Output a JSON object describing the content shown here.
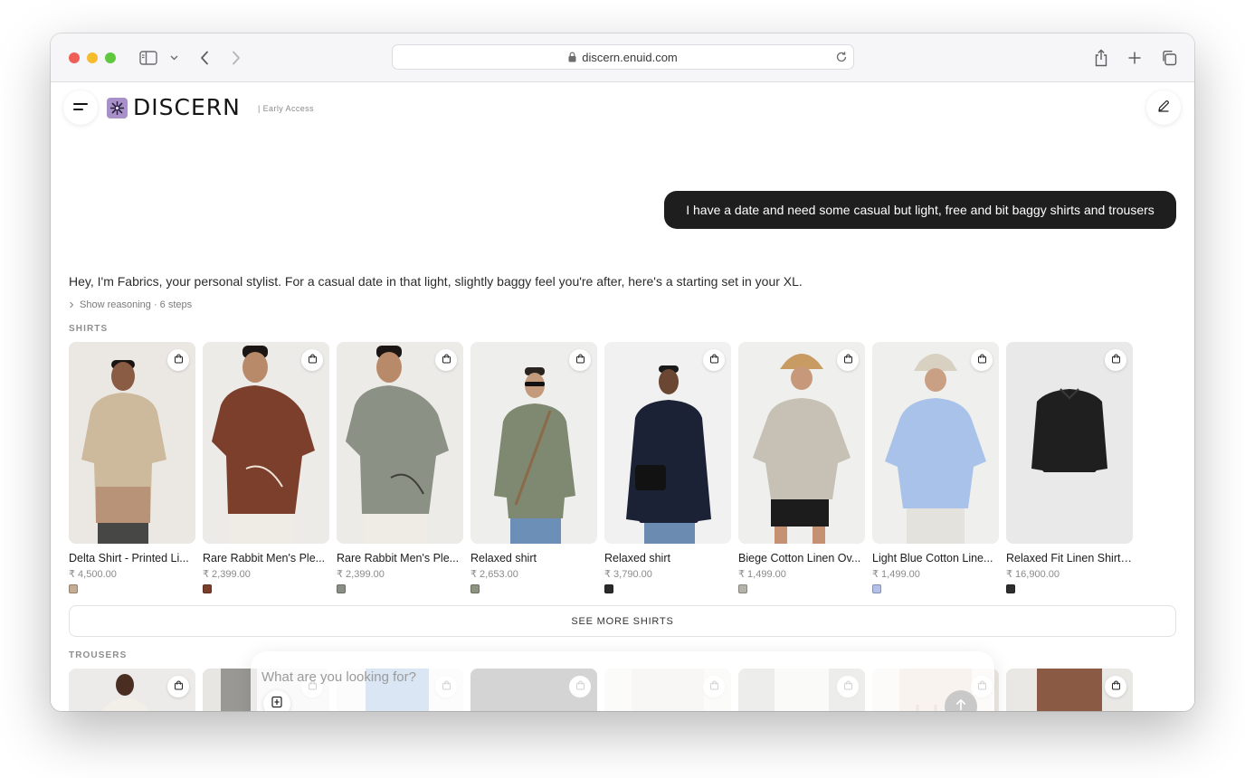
{
  "browser": {
    "url": "discern.enuid.com",
    "icons": [
      "sidebar-icon",
      "chevron-down-icon",
      "back-icon",
      "forward-icon",
      "lock-icon",
      "reload-icon",
      "share-icon",
      "new-tab-icon",
      "tabs-overview-icon"
    ]
  },
  "header": {
    "brand": "DISCERN",
    "badge": "| Early Access",
    "icons": [
      "menu-icon",
      "logo-icon",
      "edit-icon"
    ]
  },
  "chat": {
    "user_message": "I have a date and need some casual but light, free and bit baggy shirts and trousers",
    "assistant_message": "Hey, I'm Fabrics, your personal stylist. For a casual date in that light, slightly baggy feel you're after, here's a starting set in your XL.",
    "reasoning_label": "Show reasoning · 6 steps"
  },
  "shirts": {
    "section_label": "SHIRTS",
    "see_more_label": "SEE MORE SHIRTS",
    "items": [
      {
        "name": "Delta Shirt - Printed Li...",
        "price": "₹ 4,500.00",
        "swatch": "#c4ad93"
      },
      {
        "name": "Rare Rabbit Men's Ple...",
        "price": "₹ 2,399.00",
        "swatch": "#7a3e2a"
      },
      {
        "name": "Rare Rabbit Men's Ple...",
        "price": "₹ 2,399.00",
        "swatch": "#8a8f86"
      },
      {
        "name": "Relaxed shirt",
        "price": "₹ 2,653.00",
        "swatch": "#8e937f"
      },
      {
        "name": "Relaxed shirt",
        "price": "₹ 3,790.00",
        "swatch": "#2a2a2a"
      },
      {
        "name": "Biege Cotton Linen Ov...",
        "price": "₹ 1,499.00",
        "swatch": "#b5b2aa"
      },
      {
        "name": "Light Blue Cotton Line...",
        "price": "₹ 1,499.00",
        "swatch": "#b3c0ea"
      },
      {
        "name": "Relaxed Fit Linen Shirt ...",
        "price": "₹ 16,900.00",
        "swatch": "#2e2e2e"
      }
    ]
  },
  "trousers": {
    "section_label": "TROUSERS"
  },
  "composer": {
    "placeholder": "What are you looking for?"
  }
}
